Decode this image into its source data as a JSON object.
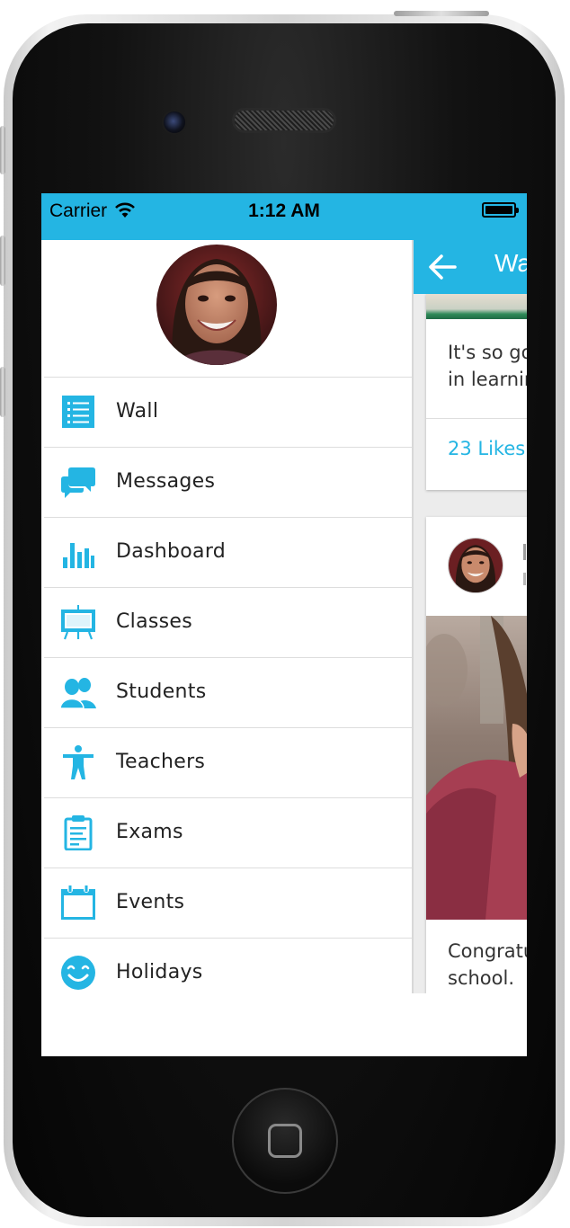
{
  "status_bar": {
    "carrier": "Carrier",
    "time": "1:12 AM"
  },
  "drawer": {
    "menu": [
      {
        "label": "Wall",
        "icon": "list-icon"
      },
      {
        "label": "Messages",
        "icon": "chat-bubbles-icon"
      },
      {
        "label": "Dashboard",
        "icon": "bar-chart-icon"
      },
      {
        "label": "Classes",
        "icon": "easel-board-icon"
      },
      {
        "label": "Students",
        "icon": "people-icon"
      },
      {
        "label": "Teachers",
        "icon": "person-icon"
      },
      {
        "label": "Exams",
        "icon": "clipboard-icon"
      },
      {
        "label": "Events",
        "icon": "calendar-icon"
      },
      {
        "label": "Holidays",
        "icon": "smiley-icon"
      }
    ]
  },
  "wall": {
    "title": "Wa",
    "post1": {
      "line1": "It's so go",
      "line2": "in learnin",
      "likes": "23 Likes"
    },
    "post2": {
      "line1": "Congratu",
      "line2": "school."
    }
  },
  "colors": {
    "accent": "#24b5e3",
    "icon": "#24b5e3",
    "phone_body": "#111111"
  }
}
